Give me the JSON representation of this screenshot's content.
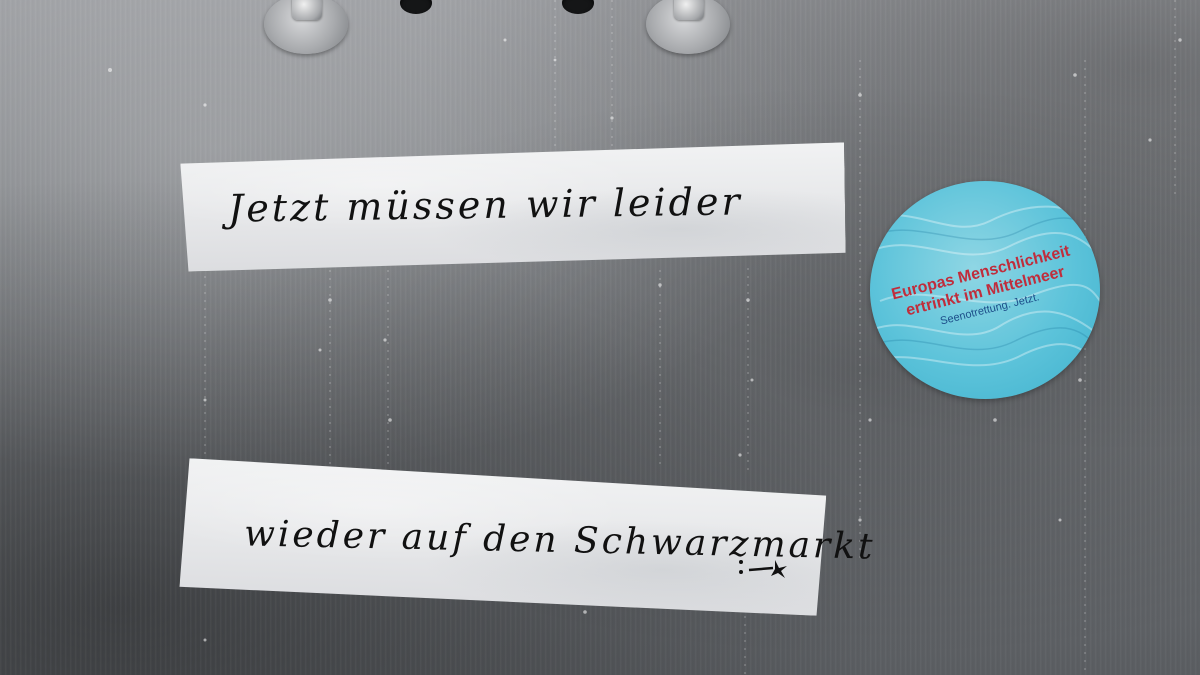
{
  "tape_notes": [
    {
      "text": "Jetzt müssen wir leider"
    },
    {
      "text": "wieder auf den Schwarzmarkt"
    }
  ],
  "sticker": {
    "line1": "Europas Menschlichkeit",
    "line2": "ertrinkt im Mittelmeer",
    "subline": "Seenotrettung. Jetzt.",
    "colors": {
      "background": "#5cc3da",
      "headline": "#c02d3c",
      "subline": "#1d4f8a"
    }
  },
  "colors": {
    "metal": "#7f8286",
    "tape": "#e6e7e9",
    "ink": "#111111"
  }
}
